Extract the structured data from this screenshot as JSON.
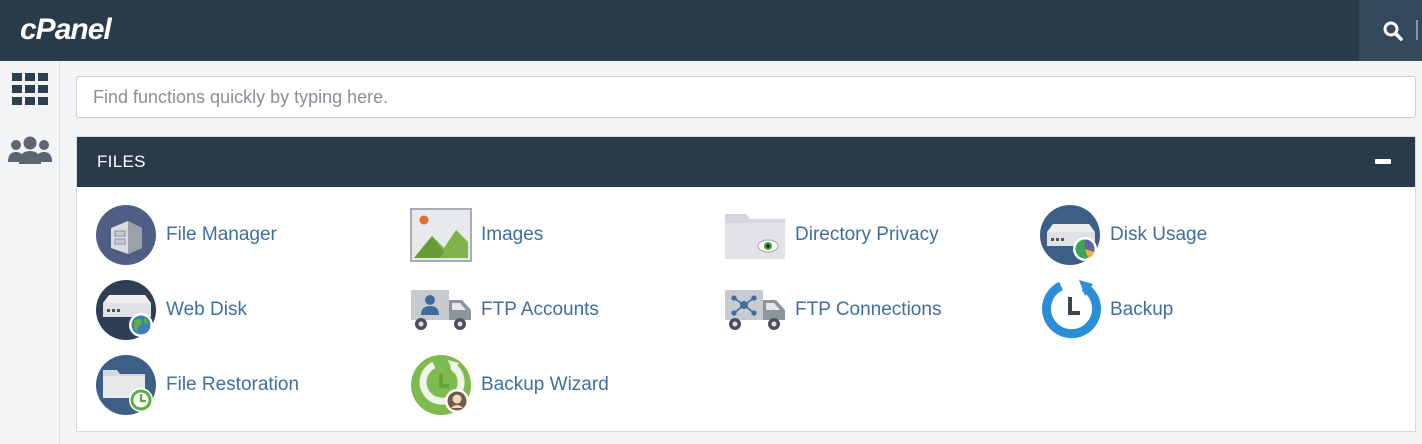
{
  "header": {
    "logo_text": "cPanel",
    "search_icon": "search-icon"
  },
  "sidebar": {
    "items": [
      {
        "icon": "grid-icon"
      },
      {
        "icon": "users-icon"
      }
    ]
  },
  "search": {
    "placeholder": "Find functions quickly by typing here."
  },
  "files": {
    "title": "FILES",
    "collapse_icon": "minus-icon",
    "items": [
      {
        "label": "File Manager",
        "icon": "file-manager-icon"
      },
      {
        "label": "Images",
        "icon": "images-icon"
      },
      {
        "label": "Directory Privacy",
        "icon": "directory-privacy-icon"
      },
      {
        "label": "Disk Usage",
        "icon": "disk-usage-icon"
      },
      {
        "label": "Web Disk",
        "icon": "web-disk-icon"
      },
      {
        "label": "FTP Accounts",
        "icon": "ftp-accounts-icon"
      },
      {
        "label": "FTP Connections",
        "icon": "ftp-connections-icon"
      },
      {
        "label": "Backup",
        "icon": "backup-icon"
      },
      {
        "label": "File Restoration",
        "icon": "file-restoration-icon"
      },
      {
        "label": "Backup Wizard",
        "icon": "backup-wizard-icon"
      }
    ]
  },
  "colors": {
    "header_bg": "#293a4a",
    "link": "#3e6f9e",
    "page_bg": "#f3f4f6"
  }
}
